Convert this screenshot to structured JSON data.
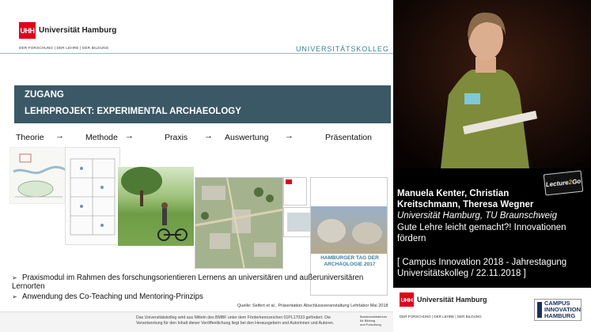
{
  "slide": {
    "logo": {
      "mark": "UHH",
      "name": "Universität Hamburg",
      "tagline": "DER FORSCHUNG | DER LEHRE | DER BILDUNG"
    },
    "kolleg": "UNIVERSITÄTSKOLLEG",
    "zugang": "ZUGANG",
    "project": "LEHRPROJEKT: EXPERIMENTAL ARCHAEOLOGY",
    "flow": [
      "Theorie",
      "Methode",
      "Praxis",
      "Auswertung",
      "Präsentation"
    ],
    "arrow": "→",
    "poster": {
      "title": "HAMBURGER TAG DER ARCHÄOLOGIE 2017"
    },
    "bullets": [
      "Praxismodul im Rahmen des forschungsorientieren Lernens an universitären und außeruniversitären Lernorten",
      "Anwendung des Co-Teaching und Mentoring-Prinzips"
    ],
    "source": "Quelle: Seifert et al., Präsentation Abschlussveranstaltung Lehrlabor Mai 2018",
    "footer": [
      "Das Universitätskolleg wird aus Mitteln des BMBF unter dem Förderkennzeichen 01PL17033 gefördert. Die",
      "Verantwortung für den Inhalt dieser Veröffentlichung liegt bei den Herausgebern und Autorinnen und Autoren."
    ],
    "bmbf": [
      "Bundesministerium",
      "für Bildung",
      "und Forschung"
    ]
  },
  "sidebar": {
    "badge": {
      "part1": "Lecture",
      "part2": "2",
      "part3": "Go"
    },
    "speakers_line1": "Manuela Kenter, Christian",
    "speakers_line2": "Kreitschmann, Theresa Wegner",
    "affiliation": "Universität Hamburg, TU Braunschweig",
    "talk_line1": "Gute Lehre leicht gemacht?! Innovationen",
    "talk_line2": "fördern",
    "event_line1": "[ Campus Innovation 2018 - Jahrestagung",
    "event_line2": "Universitätskolleg / 22.11.2018 ]",
    "bottom_logo": {
      "mark": "UHH",
      "name": "Universität Hamburg",
      "tagline": "DER FORSCHUNG | DER LEHRE | DER BILDUNG"
    },
    "ci_logo": [
      "CAMPUS",
      "INNOVATION",
      "HAMBURG"
    ]
  },
  "colors": {
    "accent_red": "#e2001a",
    "slide_header": "#3b5866",
    "kolleg": "#3a7ea0"
  }
}
